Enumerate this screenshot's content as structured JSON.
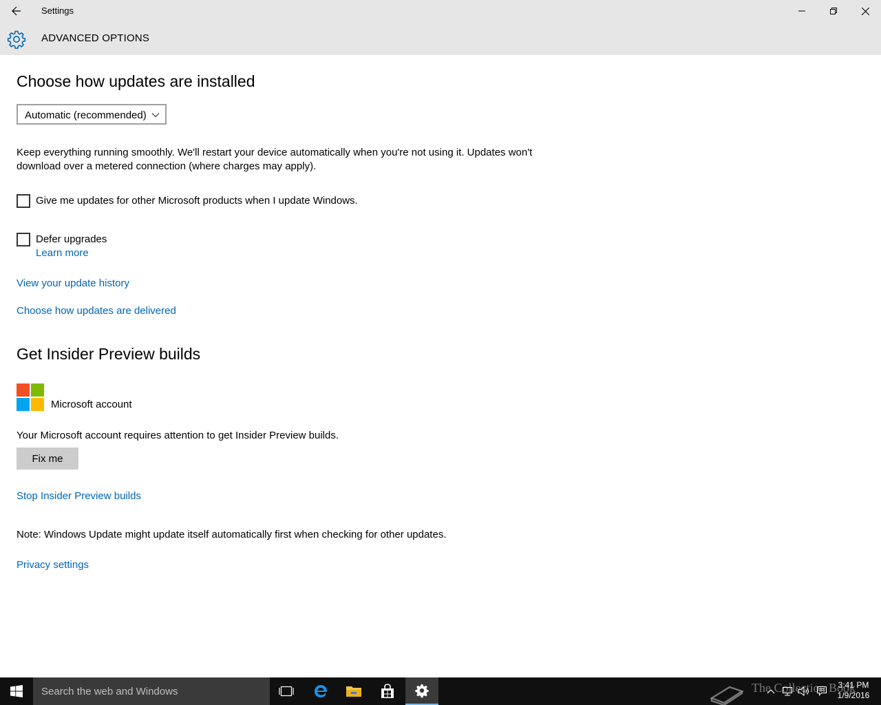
{
  "window": {
    "title": "Settings"
  },
  "header": {
    "title": "ADVANCED OPTIONS"
  },
  "install": {
    "heading": "Choose how updates are installed",
    "dropdown_value": "Automatic (recommended)",
    "description": "Keep everything running smoothly. We'll restart your device automatically when you're not using it. Updates won't download over a metered connection (where charges may apply)."
  },
  "options": {
    "other_products_label": "Give me updates for other Microsoft products when I update Windows.",
    "other_products_checked": false,
    "defer_label": "Defer upgrades",
    "defer_checked": false,
    "learn_more": "Learn more"
  },
  "links": {
    "update_history": "View your update history",
    "delivery": "Choose how updates are delivered",
    "stop_insider": "Stop Insider Preview builds",
    "privacy": "Privacy settings"
  },
  "insider": {
    "heading": "Get Insider Preview builds",
    "account_label": "Microsoft account",
    "attention_text": "Your Microsoft account requires attention to get Insider Preview builds.",
    "fix_button": "Fix me"
  },
  "note": "Note: Windows Update might update itself automatically first when checking for other updates.",
  "taskbar": {
    "search_placeholder": "Search the web and Windows",
    "time": "3:41 PM",
    "date": "1/9/2016",
    "watermark": "The Collection Book"
  },
  "colors": {
    "accent": "#0066b4",
    "chrome": "#e6e6e6",
    "taskbar": "#101010",
    "ms_red": "#f25022",
    "ms_green": "#7fba00",
    "ms_blue": "#00a4ef",
    "ms_yellow": "#ffb900"
  }
}
